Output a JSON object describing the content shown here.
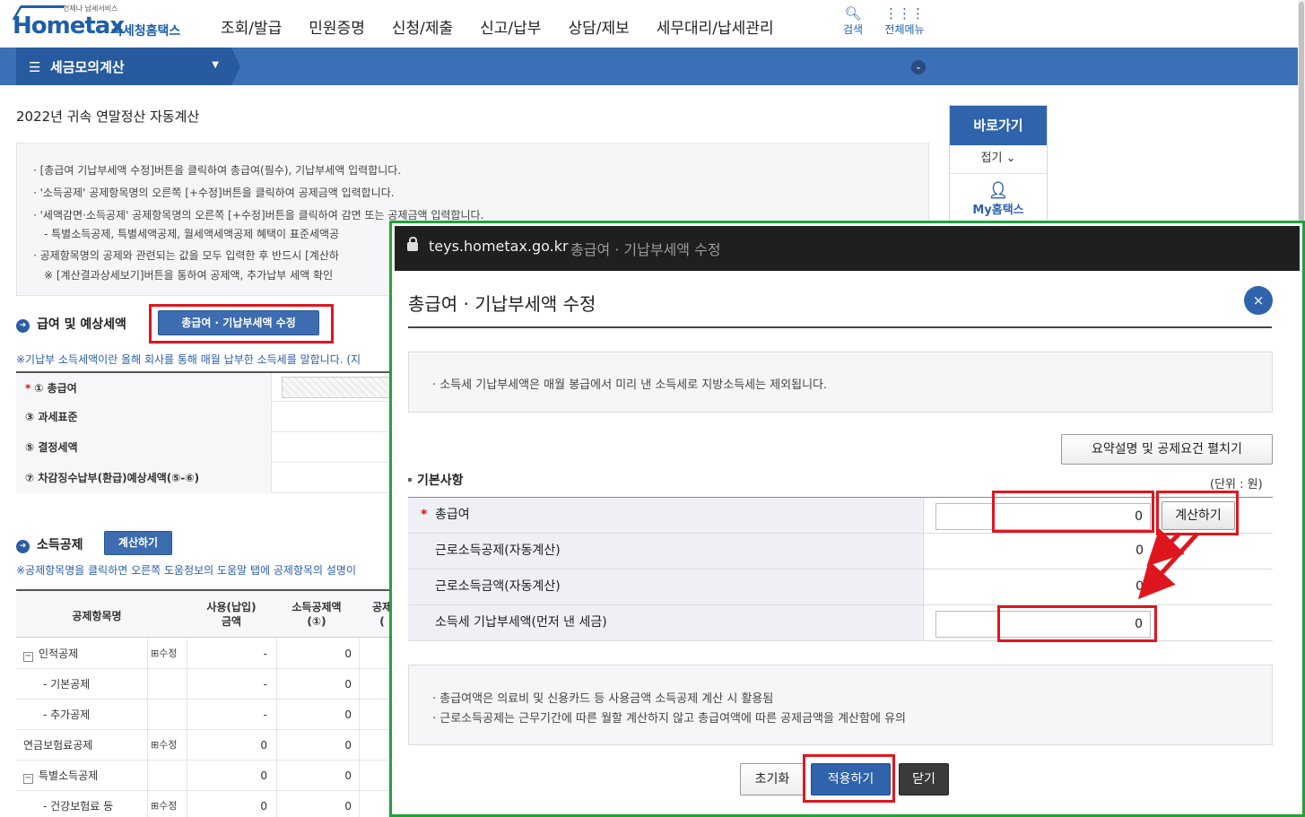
{
  "header": {
    "logo_sub": "언제나 납세서비스",
    "logo_text": "Hometax",
    "logo_kr": "국세청홈택스",
    "menu": [
      "조회/발급",
      "민원증명",
      "신청/제출",
      "신고/납부",
      "상담/제보",
      "세무대리/납세관리"
    ],
    "search_label": "검색",
    "allmenu_label": "전체메뉴"
  },
  "nav": {
    "title": "세금모의계산"
  },
  "page": {
    "title": "2022년 귀속 연말정산 자동계산",
    "info": [
      "· [총급여 기납부세액 수정]버튼을 클릭하여 총급여(필수), 기납부세액 입력합니다.",
      "· '소득공제' 공제항목명의 오른쪽 [+수정]버튼을 클릭하여 공제금액 입력합니다.",
      "· '세액감면·소득공제' 공제항목명의 오른쪽 [+수정]버튼을 클릭하여 감면 또는 공제금액 입력합니다.",
      "- 특별소득공제, 특별세액공제, 월세액세액공제 혜택이 표준세액공",
      "· 공제항목명의 공제와 관련되는 값을 모두 입력한 후 반드시 [계산하",
      "※ [계산결과상세보기]버튼을 통하여 공제액, 추가납부 세액 확인"
    ],
    "section1_title": "급여 및 예상세액",
    "section1_btn": "총급여 · 기납부세액 수정",
    "section1_note": "※기납부 소득세액이란 올해 회사를 통해 매월 납부한 소득세를 말합니다. (지",
    "rows": [
      {
        "label": "① 총급여",
        "required": "*"
      },
      {
        "label": "③ 과세표준"
      },
      {
        "label": "⑤ 결정세액"
      },
      {
        "label": "⑦ 차감징수납부(환급)예상세액(⑤-⑥)"
      }
    ],
    "section2_title": "소득공제",
    "section2_btn": "계산하기",
    "section2_note": "※공제항목명을 클릭하면 오른쪽 도움정보의 도움말 탭에 공제항목의 설명이",
    "table": {
      "headers": [
        "공제항목명",
        "사용(납입)\n금액",
        "소득공제액\n(①)",
        "공제\n("
      ],
      "rows": [
        {
          "name": "인적공제",
          "toggle": "−",
          "edit": "⊞수정",
          "amount": "-",
          "deduct": "0"
        },
        {
          "name": "- 기본공제",
          "amount": "-",
          "deduct": "0"
        },
        {
          "name": "- 추가공제",
          "amount": "-",
          "deduct": "0"
        },
        {
          "name": "연금보험료공제",
          "edit": "⊞수정",
          "amount": "0",
          "deduct": "0"
        },
        {
          "name": "특별소득공제",
          "toggle": "−",
          "amount": "0",
          "deduct": "0"
        },
        {
          "name": "- 건강보험료 등",
          "edit": "⊞수정",
          "amount": "0",
          "deduct": "0"
        }
      ]
    }
  },
  "quick": {
    "title": "바로가기",
    "fold": "접기",
    "item": "My홈택스"
  },
  "popup": {
    "url": "teys.hometax.go.kr",
    "window_title": "총급여 · 기납부세액 수정",
    "heading": "총급여 · 기납부세액 수정",
    "close_icon": "×",
    "info": "· 소득세 기납부세액은 매월 봉급에서 미리 낸 소득세로 지방소득세는 제외됩니다.",
    "expand_btn": "요약설명 및 공제요건 펼치기",
    "section": "기본사항",
    "unit": "(단위 : 원)",
    "rows": [
      {
        "label": "총급여",
        "required": "*",
        "value": "0",
        "button": "계산하기"
      },
      {
        "label": "근로소득공제(자동계산)",
        "value": "0"
      },
      {
        "label": "근로소득금액(자동계산)",
        "value": "0"
      },
      {
        "label": "소득세 기납부세액(먼저 낸 세금)",
        "value": "0"
      }
    ],
    "notes": [
      "· 총급여액은 의료비 및 신용카드 등 사용금액 소득공제 계산 시 활용됨",
      "· 근로소득공제는 근무기간에 따른 월할 계산하지 않고 총급여액에 따른 공제금액을 계산함에 유의"
    ],
    "btn_reset": "초기화",
    "btn_apply": "적용하기",
    "btn_close": "닫기"
  },
  "colors": {
    "accent": "#2f63ab",
    "highlight": "#e0161e",
    "popup_border": "#21a33a"
  }
}
